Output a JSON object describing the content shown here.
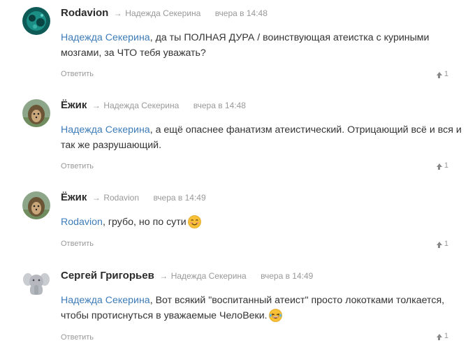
{
  "comments": [
    {
      "author": "Rodavion",
      "arrow": "→",
      "reply_to": "Надежда Секерина",
      "time": "вчера в 14:48",
      "mention": "Надежда Секерина",
      "text": ", да ты ПОЛНАЯ ДУРА / воинствующая атеистка с куриными мозгами, за ЧТО тебя уважать?",
      "reply_label": "Ответить",
      "votes": "1",
      "avatar_icon": "underwater-avatar-icon"
    },
    {
      "author": "Ёжик",
      "arrow": "→",
      "reply_to": "Надежда Секерина",
      "time": "вчера в 14:48",
      "mention": "Надежда Секерина",
      "text": ", а ещё опаснее фанатизм атеистический. Отрицающий всё и вся и так же разрушающий.",
      "reply_label": "Ответить",
      "votes": "1",
      "avatar_icon": "hedgehog-avatar-icon"
    },
    {
      "author": "Ёжик",
      "arrow": "→",
      "reply_to": "Rodavion",
      "time": "вчера в 14:49",
      "mention": "Rodavion",
      "text": ", грубо, но по сути",
      "emoji": "smile-emoji-icon",
      "reply_label": "Ответить",
      "votes": "1",
      "avatar_icon": "hedgehog-avatar-icon"
    },
    {
      "author": "Сергей Григорьев",
      "arrow": "→",
      "reply_to": "Надежда Секерина",
      "time": "вчера в 14:49",
      "mention": "Надежда Секерина",
      "text": ", Вот всякий \"воспитанный атеист\" просто локотками толкается, чтобы протиснуться в уважаемые ЧелоВеки.",
      "emoji": "laughing-emoji-icon",
      "reply_label": "Ответить",
      "votes": "1",
      "avatar_icon": "elephant-avatar-icon"
    }
  ],
  "colors": {
    "mention": "#3d7cb9",
    "muted": "#999999",
    "text": "#333333"
  }
}
